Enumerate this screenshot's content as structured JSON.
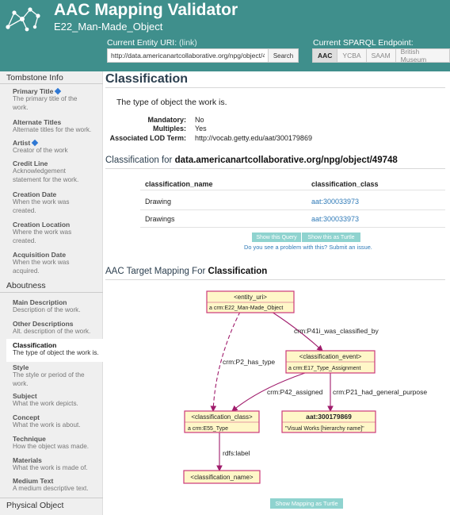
{
  "header": {
    "title": "AAC Mapping Validator",
    "subtitle": "E22_Man-Made_Object",
    "uri_label": "Current Entity URI:",
    "uri_link": "(link)",
    "uri_value": "http://data.americanartcollaborative.org/npg/object/4974",
    "search_label": "Search",
    "endpoint_label": "Current SPARQL Endpoint:",
    "endpoints": [
      "AAC",
      "YCBA",
      "SAAM",
      "British Museum"
    ],
    "active_endpoint": "AAC",
    "colors": {
      "header_bg": "#3f8f8c",
      "accent_button": "#8fd3cf",
      "link": "#2f7ab8",
      "required_marker": "#2f78d4"
    }
  },
  "sidebar": {
    "section_tombstone": "Tombstone Info",
    "section_aboutness": "Aboutness",
    "section_physical": "Physical Object",
    "tombstone_items": [
      {
        "title": "Primary Title",
        "required": true,
        "desc": [
          "The primary title of the",
          "work."
        ]
      },
      {
        "title": "Alternate Titles",
        "required": false,
        "desc": [
          "Alternate titles for the work."
        ]
      },
      {
        "title": "Artist",
        "required": true,
        "desc": [
          "Creator of the work"
        ]
      },
      {
        "title": "Credit Line",
        "required": false,
        "desc": [
          "Acknowledgement",
          "statement for the work."
        ]
      },
      {
        "title": "Creation Date",
        "required": false,
        "desc": [
          "When the work was",
          "created."
        ]
      },
      {
        "title": "Creation Location",
        "required": false,
        "desc": [
          "Where the work was",
          "created."
        ]
      },
      {
        "title": "Acquisition Date",
        "required": false,
        "desc": [
          "When the work was",
          "acquired."
        ]
      }
    ],
    "aboutness_items": [
      {
        "title": "Main Description",
        "desc": [
          "Description of the work."
        ]
      },
      {
        "title": "Other Descriptions",
        "desc": [
          "Alt. description of the work."
        ]
      },
      {
        "title": "Classification",
        "desc": [
          "The type of object the work is."
        ],
        "active": true
      },
      {
        "title": "Style",
        "desc": [
          "The style or period of the",
          "work."
        ]
      },
      {
        "title": "Subject",
        "desc": [
          "What the work depicts."
        ]
      },
      {
        "title": "Concept",
        "desc": [
          "What the work is about."
        ]
      },
      {
        "title": "Technique",
        "desc": [
          "How the object was made."
        ]
      },
      {
        "title": "Materials",
        "desc": [
          "What the work is made of."
        ]
      },
      {
        "title": "Medium Text",
        "desc": [
          "A medium descriptive text."
        ]
      }
    ]
  },
  "main": {
    "title": "Classification",
    "description": "The type of object the work is.",
    "props": [
      {
        "key": "Mandatory:",
        "value": "No"
      },
      {
        "key": "Multiples:",
        "value": "Yes"
      },
      {
        "key": "Associated LOD Term:",
        "value": "http://vocab.getty.edu/aat/300179869"
      }
    ],
    "results_heading_prefix": "Classification for ",
    "results_heading_bold": "data.americanartcollaborative.org/npg/object/49748",
    "table": {
      "columns": [
        "classification_name",
        "classification_class"
      ],
      "rows": [
        [
          "Drawing",
          "aat:300033973"
        ],
        [
          "Drawings",
          "aat:300033973"
        ]
      ]
    },
    "show_query_label": "Show this Query",
    "show_turtle_label": "Show this as Turtle",
    "issue_text": "Do you see a problem with this? Submit an issue.",
    "mapping_heading_prefix": "AAC Target Mapping For ",
    "mapping_heading_bold": "Classification",
    "show_mapping_label": "Show Mapping as Turtle"
  },
  "diagram": {
    "nodes": [
      {
        "id": "entity",
        "label": "<entity_uri>",
        "type": "a crm:E22_Man-Made_Object"
      },
      {
        "id": "event",
        "label": "<classification_event>",
        "type": "a crm:E17_Type_Assignment"
      },
      {
        "id": "class",
        "label": "<classification_class>",
        "type": "a crm:E55_Type"
      },
      {
        "id": "aat",
        "label": "aat:300179869",
        "type": "\"Visual Works [hierarchy name]\""
      },
      {
        "id": "name",
        "label": "<classification_name>"
      }
    ],
    "edges": [
      {
        "from": "entity",
        "to": "event",
        "label": "crm:P41i_was_classified_by",
        "dashed": false
      },
      {
        "from": "entity",
        "to": "class",
        "label": "crm:P2_has_type",
        "dashed": true
      },
      {
        "from": "event",
        "to": "class",
        "label": "crm:P42_assigned",
        "dashed": false
      },
      {
        "from": "event",
        "to": "aat",
        "label": "crm:P21_had_general_purpose",
        "dashed": false
      },
      {
        "from": "class",
        "to": "name",
        "label": "rdfs:label",
        "dashed": false
      }
    ],
    "colors": {
      "node_fill": "#fff7c8",
      "node_border": "#cc3a7a",
      "edge": "#a01c6c"
    }
  }
}
